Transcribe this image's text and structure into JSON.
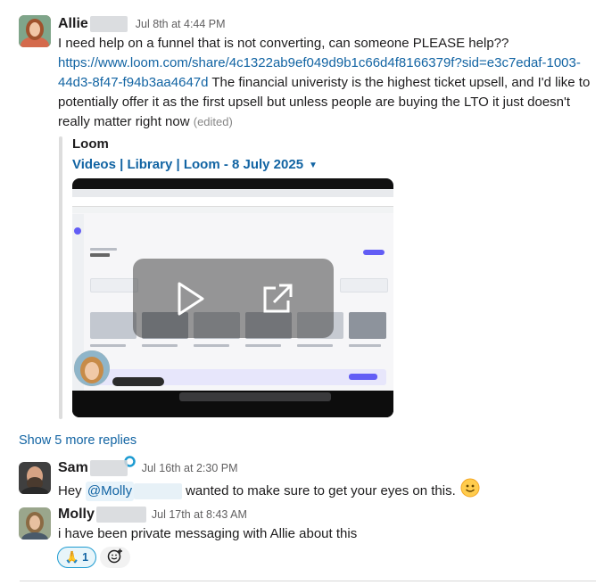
{
  "messages": [
    {
      "author": "Allie",
      "timestamp": "Jul 8th at 4:44 PM",
      "text_line1": "I need help on a funnel that is not converting, can someone PLEASE help??",
      "link_part1": "https://www.loom.com/share/4c1322ab9ef049d9b1c66d4f8166379f?sid=e3c7edaf-1003-",
      "link_part2": "44d3-8f47-f94b3aa4647d",
      "text_line2b": " The financial univeristy is the highest ticket upsell, and I'd like to",
      "text_line3": "potentially offer it as the first upsell but unless people are buying the LTO it just doesn't",
      "text_line4": "really matter right now",
      "edited": "(edited)"
    },
    {
      "author": "Sam",
      "timestamp": "Jul 16th at 2:30 PM",
      "text_before": "Hey ",
      "mention": "@Molly",
      "text_after": "wanted to make sure to get your eyes on this."
    },
    {
      "author": "Molly",
      "timestamp": "Jul 17th at 8:43 AM",
      "text": "i have been private messaging with Allie about this"
    }
  ],
  "unfurl": {
    "provider": "Loom",
    "title": "Videos | Library | Loom - 8 July 2025"
  },
  "thread": {
    "show_more": "Show 5 more replies"
  },
  "reaction": {
    "emoji": "🙏",
    "count": "1"
  },
  "icons": {
    "play": "play-icon",
    "external": "open-external-icon",
    "emoji": "slightly-smiling-face-emoji",
    "add_reaction": "add-reaction-icon",
    "caret": "caret-down-icon",
    "verified": "verified-badge-icon"
  }
}
